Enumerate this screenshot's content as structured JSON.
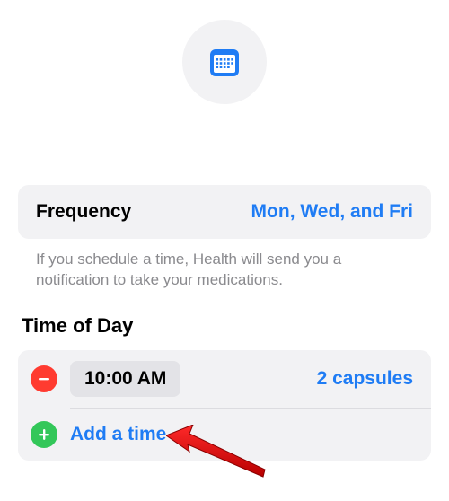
{
  "header": {
    "icon_name": "calendar-icon"
  },
  "frequency": {
    "label": "Frequency",
    "value": "Mon, Wed, and Fri"
  },
  "helper_text": "If you schedule a time, Health will send you a notification to take your medications.",
  "time_of_day": {
    "heading": "Time of Day",
    "rows": [
      {
        "time": "10:00 AM",
        "dose": "2 capsules"
      }
    ],
    "add_label": "Add a time"
  },
  "colors": {
    "accent": "#1f7cf4",
    "remove": "#ff3b30",
    "add": "#33c759",
    "card": "#f2f2f4"
  }
}
